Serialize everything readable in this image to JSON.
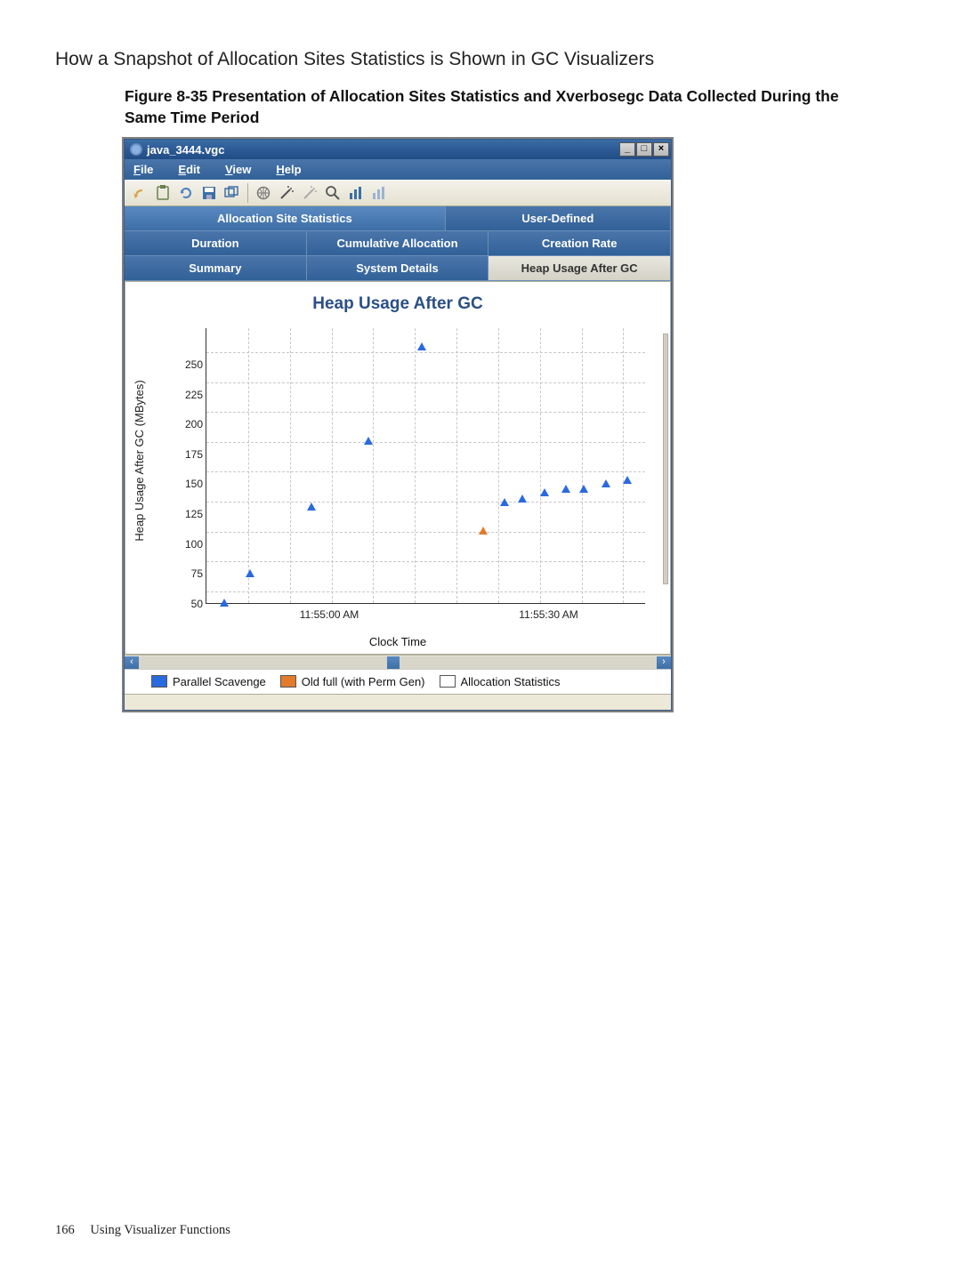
{
  "section_title": "How a Snapshot of Allocation Sites Statistics is Shown in GC Visualizers",
  "figure_caption": "Figure 8-35 Presentation of Allocation Sites Statistics and Xverbosegc Data Collected During the Same Time Period",
  "window": {
    "title": "java_3444.vgc",
    "menu": {
      "file": "File",
      "edit": "Edit",
      "view": "View",
      "help": "Help"
    },
    "tabs_row1": {
      "left": "Allocation Site Statistics",
      "right": "User-Defined"
    },
    "tabs_row2": {
      "a": "Duration",
      "b": "Cumulative Allocation",
      "c": "Creation Rate"
    },
    "tabs_row3": {
      "a": "Summary",
      "b": "System Details",
      "c": "Heap Usage After GC"
    }
  },
  "legend": {
    "a": "Parallel Scavenge",
    "b": "Old full (with Perm Gen)",
    "c": "Allocation Statistics"
  },
  "footer": {
    "page": "166",
    "chapter": "Using Visualizer Functions"
  },
  "chart_data": {
    "type": "scatter",
    "title": "Heap Usage After GC",
    "xlabel": "Clock Time",
    "ylabel": "Heap Usage After GC  (MBytes)",
    "ylim": [
      40,
      270
    ],
    "yticks": [
      50,
      75,
      100,
      125,
      150,
      175,
      200,
      225,
      250
    ],
    "xticks": [
      "11:55:00 AM",
      "11:55:30 AM"
    ],
    "series": [
      {
        "name": "Parallel Scavenge",
        "color": "#2a6adf",
        "points": [
          {
            "x": 0.04,
            "y": 48
          },
          {
            "x": 0.1,
            "y": 72
          },
          {
            "x": 0.24,
            "y": 128
          },
          {
            "x": 0.37,
            "y": 183
          },
          {
            "x": 0.49,
            "y": 262
          },
          {
            "x": 0.68,
            "y": 132
          },
          {
            "x": 0.72,
            "y": 135
          },
          {
            "x": 0.77,
            "y": 140
          },
          {
            "x": 0.82,
            "y": 143
          },
          {
            "x": 0.86,
            "y": 143
          },
          {
            "x": 0.91,
            "y": 147
          },
          {
            "x": 0.96,
            "y": 150
          }
        ]
      },
      {
        "name": "Old full (with Perm Gen)",
        "color": "#e27b2a",
        "points": [
          {
            "x": 0.63,
            "y": 108
          }
        ]
      },
      {
        "name": "Allocation Statistics",
        "color": "#ffffff",
        "points": []
      }
    ]
  }
}
